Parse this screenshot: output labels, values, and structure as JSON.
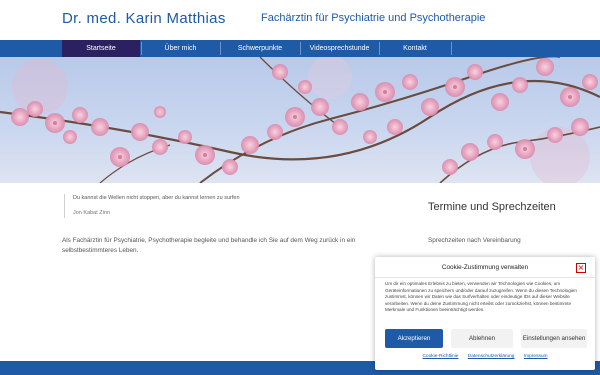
{
  "header": {
    "title": "Dr. med. Karin Matthias",
    "subtitle": "Fachärztin für Psychiatrie und Psychotherapie"
  },
  "nav": {
    "items": [
      {
        "label": "Startseite",
        "active": true
      },
      {
        "label": "Über mich",
        "active": false
      },
      {
        "label": "Schwerpunkte",
        "active": false
      },
      {
        "label": "Videosprechstunde",
        "active": false
      },
      {
        "label": "Kontakt",
        "active": false
      }
    ]
  },
  "quote": {
    "text": "Du kannst die Wellen nicht stoppen, aber du kannst lernen zu surfen",
    "author": "Jon Kabat Zinn"
  },
  "main": {
    "intro": "Als Fachärztin für Psychiatrie, Psychotherapie begleite und behandle ich Sie auf dem Weg zurück in ein selbstbestimmteres Leben."
  },
  "sidebar": {
    "title": "Termine und Sprechzeiten",
    "text": "Sprechzeiten nach Vereinbarung"
  },
  "cookie": {
    "title": "Cookie-Zustimmung verwalten",
    "close_icon": "close-icon",
    "body": "Um dir ein optimales Erlebnis zu bieten, verwenden wir Technologien wie Cookies, um Geräteinformationen zu speichern und/oder darauf zuzugreifen. Wenn du diesen Technologien zustimmst, können wir Daten wie das Surfverhalten oder eindeutige IDs auf dieser Website verarbeiten. Wenn du deine Zustimmung nicht erteilst oder zurückziehst, können bestimmte Merkmale und Funktionen beeinträchtigt werden.",
    "accept_label": "Akzeptieren",
    "deny_label": "Ablehnen",
    "settings_label": "Einstellungen ansehen",
    "links": [
      "Cookie-Richtlinie",
      "Datenschutzerklärung",
      "Impressum"
    ]
  },
  "colors": {
    "brand_blue": "#1e5aa6",
    "nav_active": "#2b2160",
    "blossom": "#e8a9c2"
  }
}
